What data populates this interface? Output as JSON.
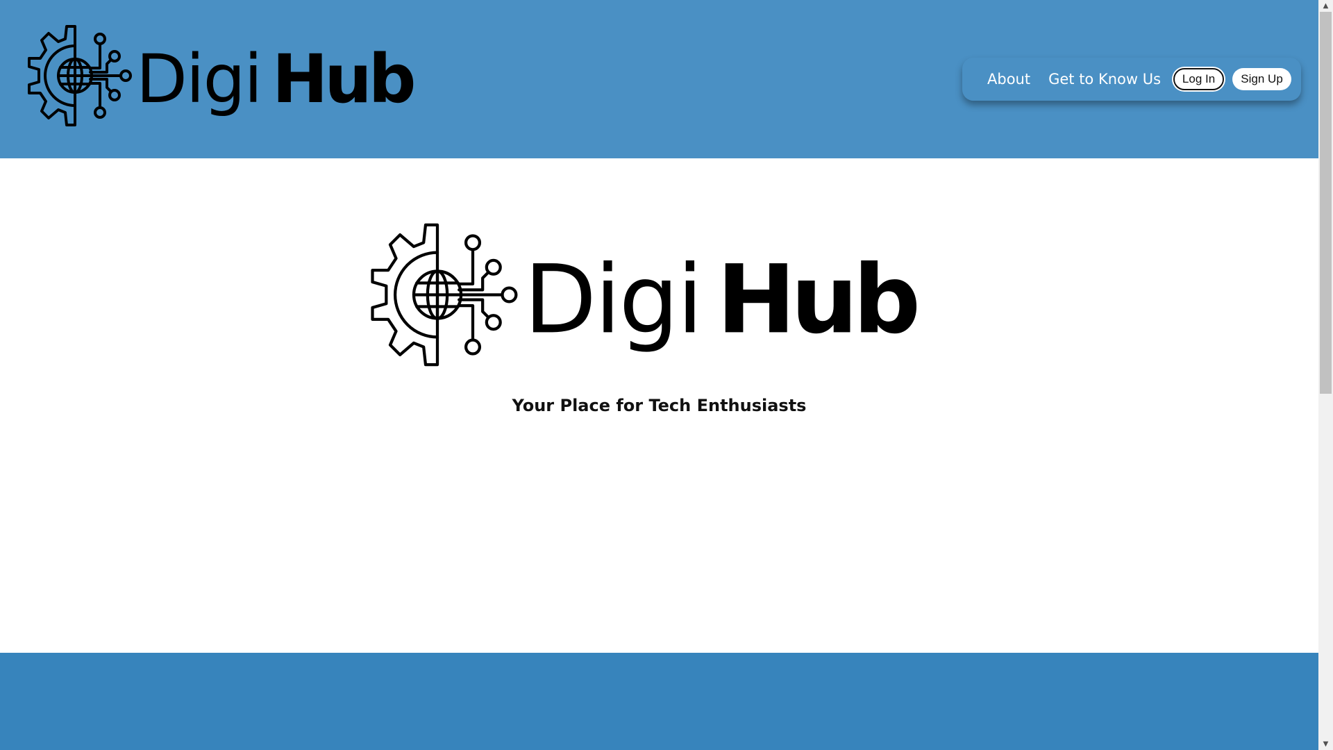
{
  "colors": {
    "header_bg": "#4a90c4",
    "footer_bg": "#3784bc",
    "nav_bg": "#4a90c4",
    "text_dark": "#111111",
    "white": "#ffffff"
  },
  "header": {
    "logo": {
      "text_light": "Digi",
      "text_bold": "Hub",
      "icon": "gear-globe-circuit-icon"
    },
    "nav": {
      "about_label": "About",
      "know_us_label": "Get to Know Us",
      "login_label": "Log In",
      "signup_label": "Sign Up"
    }
  },
  "hero": {
    "logo": {
      "text_light": "Digi",
      "text_bold": "Hub",
      "icon": "gear-globe-circuit-icon"
    },
    "tagline": "Your Place for Tech Enthusiasts"
  },
  "scrollbar": {
    "up_icon": "arrow-up-icon",
    "down_icon": "arrow-down-icon"
  }
}
